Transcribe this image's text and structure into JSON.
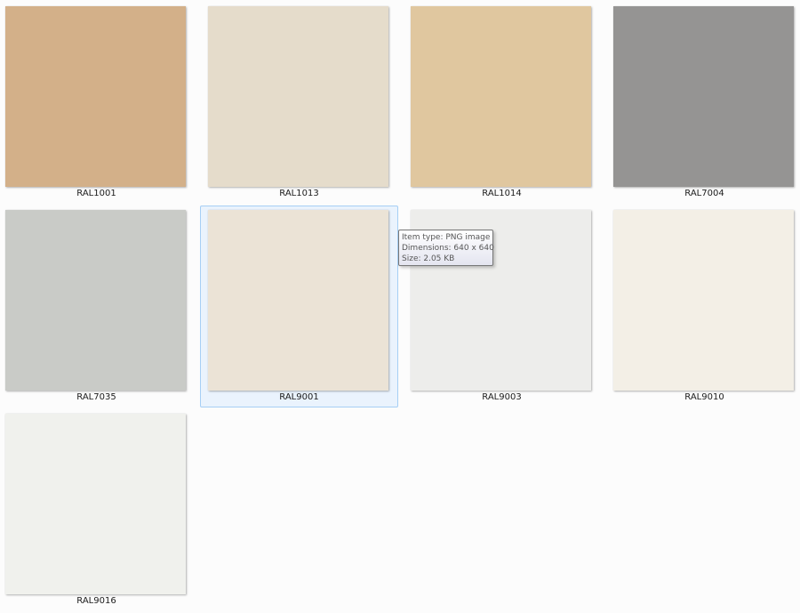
{
  "items": [
    {
      "name": "RAL1001",
      "color": "#d3b089"
    },
    {
      "name": "RAL1013",
      "color": "#e5dccb"
    },
    {
      "name": "RAL1014",
      "color": "#e0c79f"
    },
    {
      "name": "RAL7004",
      "color": "#959493"
    },
    {
      "name": "RAL7035",
      "color": "#c9cbc7"
    },
    {
      "name": "RAL9001",
      "color": "#ebe3d6",
      "selected": true
    },
    {
      "name": "RAL9003",
      "color": "#ededeb"
    },
    {
      "name": "RAL9010",
      "color": "#f3efe6"
    },
    {
      "name": "RAL9016",
      "color": "#f0f1ed"
    }
  ],
  "tooltip": {
    "type_line": "Item type: PNG image",
    "dimensions_line": "Dimensions: 640 x 640",
    "size_line": "Size: 2.05 KB"
  }
}
